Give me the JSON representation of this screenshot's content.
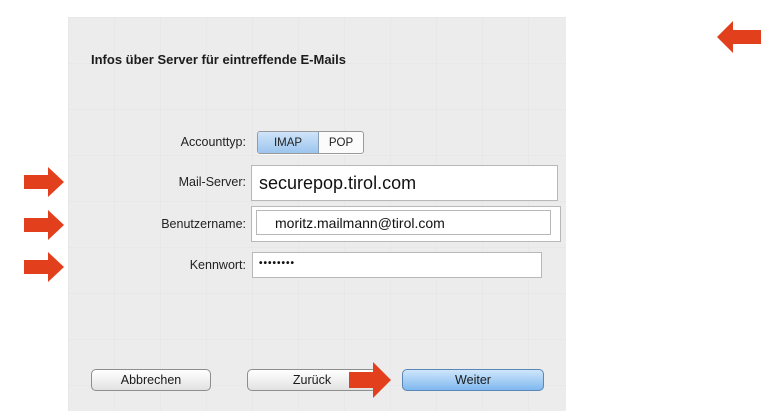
{
  "dialog": {
    "title": "Infos über Server für eintreffende E-Mails"
  },
  "form": {
    "account_type_label": "Accounttyp:",
    "account_type_options": [
      "IMAP",
      "POP"
    ],
    "account_type_selected": "IMAP",
    "mail_server_label": "Mail-Server:",
    "mail_server_value": "securepop.tirol.com",
    "username_label": "Benutzername:",
    "username_value": "moritz.mailmann@tirol.com",
    "password_label": "Kennwort:",
    "password_value": "••••••••"
  },
  "buttons": {
    "cancel": "Abbrechen",
    "back": "Zurück",
    "next": "Weiter"
  },
  "colors": {
    "annotation_arrow": "#e2401c",
    "primary_button": "#7fb8ef"
  },
  "icons": {
    "annotation": "arrow-right-icon"
  }
}
